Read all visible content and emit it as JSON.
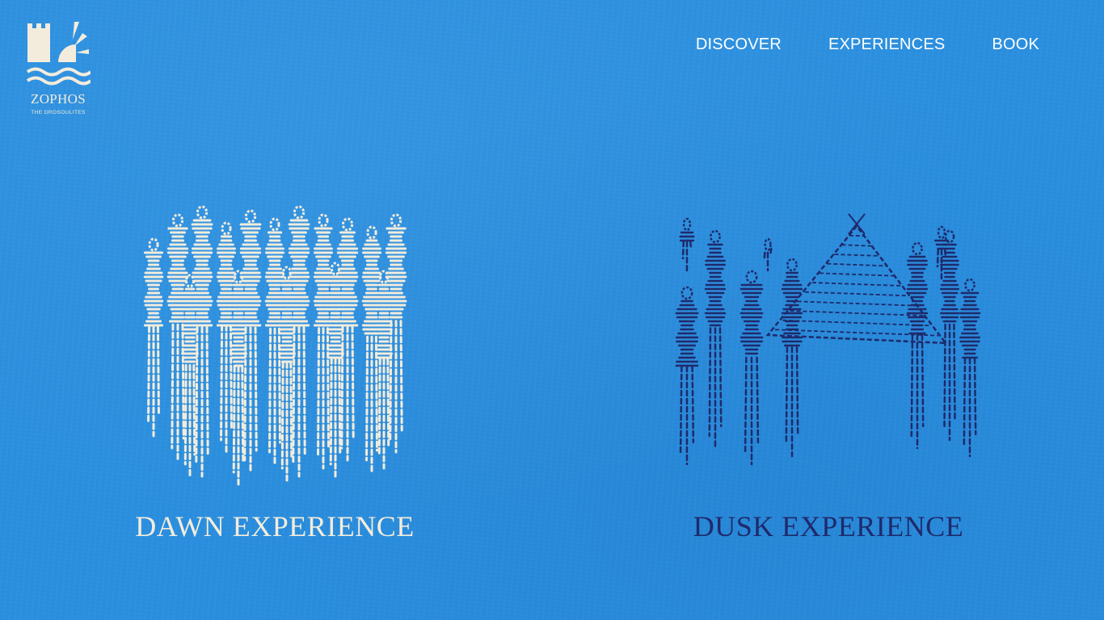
{
  "brand": {
    "name": "ZOPHOS",
    "tagline": "THE DROSOULITES",
    "logo_color": "#f3ecdc",
    "icon": "castle-sun-waves-logo"
  },
  "nav": {
    "items": [
      {
        "label": "DISCOVER"
      },
      {
        "label": "EXPERIENCES"
      },
      {
        "label": "BOOK"
      }
    ]
  },
  "experiences": [
    {
      "title": "DAWN EXPERIENCE",
      "color": "#f3ecdc",
      "illustration": "stitched-ghost-procession-illustration"
    },
    {
      "title": "DUSK EXPERIENCE",
      "color": "#1e2a6c",
      "illustration": "stitched-figures-tent-illustration"
    }
  ],
  "colors": {
    "background": "#2a8fdf",
    "nav_text": "#ffffff"
  }
}
